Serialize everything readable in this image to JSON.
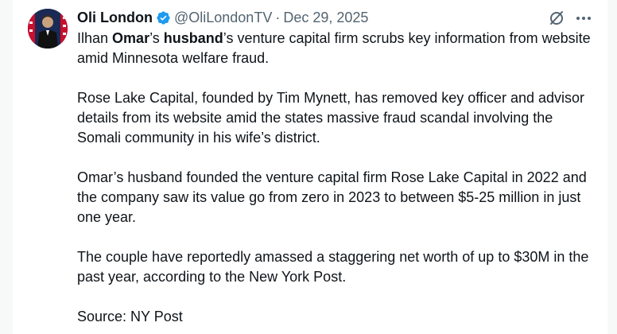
{
  "author": {
    "name": "Oli London",
    "handle": "@OliLondonTV",
    "separator": "·",
    "date": "Dec 29, 2025",
    "verified_color": "#1d9bf0"
  },
  "icons": {
    "verified": "verified-badge-icon",
    "grok": "grok-icon",
    "more": "more-icon"
  },
  "tweet": {
    "para1": {
      "t1": "Ilhan ",
      "t2": "Omar",
      "t3": "’s ",
      "t4": "husband",
      "t5": "’s venture capital firm scrubs key information from website amid Minnesota welfare fraud."
    },
    "para2": "Rose Lake Capital, founded by Tim Mynett, has removed key officer and advisor details from its website amid the states massive fraud scandal involving the Somali community in his wife’s district.",
    "para3": "Omar’s husband founded the venture capital firm Rose Lake Capital in 2022 and the company saw its value go from zero in 2023 to between $5-25 million in just one year.",
    "para4": "The couple have reportedly amassed a staggering net worth of up to $30M in the past year, according to the New York Post.",
    "para5": "Source: NY Post"
  }
}
